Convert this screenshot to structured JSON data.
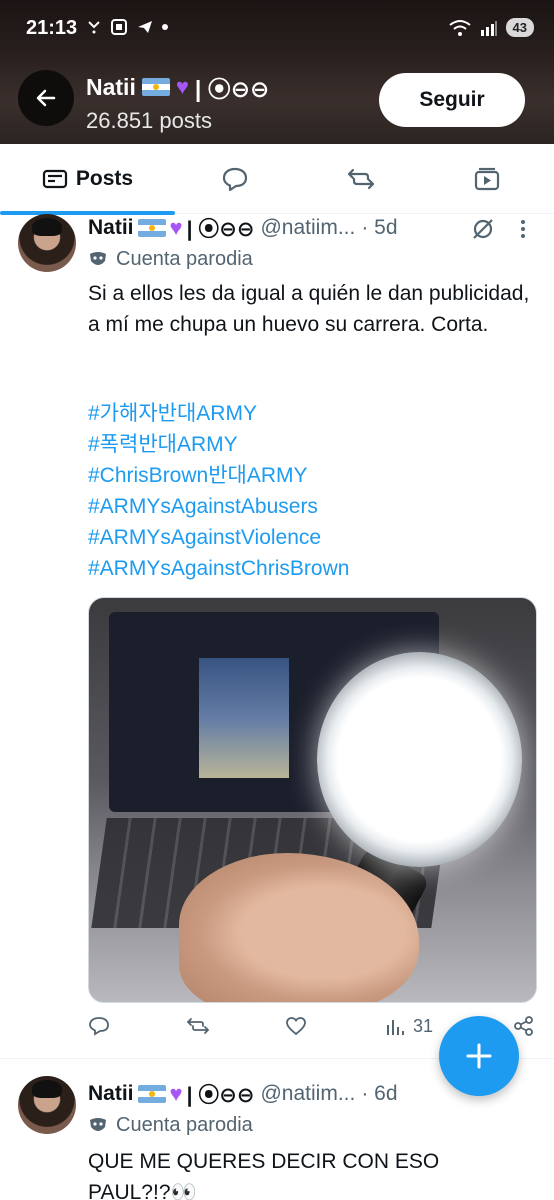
{
  "status_bar": {
    "time": "21:13",
    "battery": "43"
  },
  "header": {
    "display_name": "Natii",
    "name_suffix": "| ⦿⊖⊖",
    "post_count": "26.851 posts",
    "follow_label": "Seguir"
  },
  "tabs": {
    "posts_label": "Posts"
  },
  "posts": [
    {
      "name": "Natii",
      "name_suffix": "| ⦿⊖⊖",
      "handle": "@natiim...",
      "time": "· 5d",
      "parody_label": "Cuenta parodia",
      "text": "Si a ellos les da igual a quién le dan publicidad, a mí me chupa un huevo su carrera. Corta.",
      "hashtags": [
        "#가해자반대ARMY",
        "#폭력반대ARMY",
        "#ChrisBrown반대ARMY",
        "#ARMYsAgainstAbusers",
        "#ARMYsAgainstViolence",
        "#ARMYsAgainstChrisBrown"
      ],
      "views": "31"
    },
    {
      "name": "Natii",
      "name_suffix": "| ⦿⊖⊖",
      "handle": "@natiim...",
      "time": "· 6d",
      "parody_label": "Cuenta parodia",
      "text": "QUE ME QUERES DECIR CON ESO PAUL?!?👀"
    }
  ],
  "colors": {
    "accent": "#1d9bf0",
    "muted": "#536471",
    "heart_emoji": "#a855f7"
  },
  "icons": {
    "back": "arrow-left-icon",
    "posts_tab": "newspaper-icon",
    "replies_tab": "chat-bubble-icon",
    "reposts_tab": "repost-icon",
    "media_tab": "media-icon",
    "fab": "plus-icon"
  }
}
